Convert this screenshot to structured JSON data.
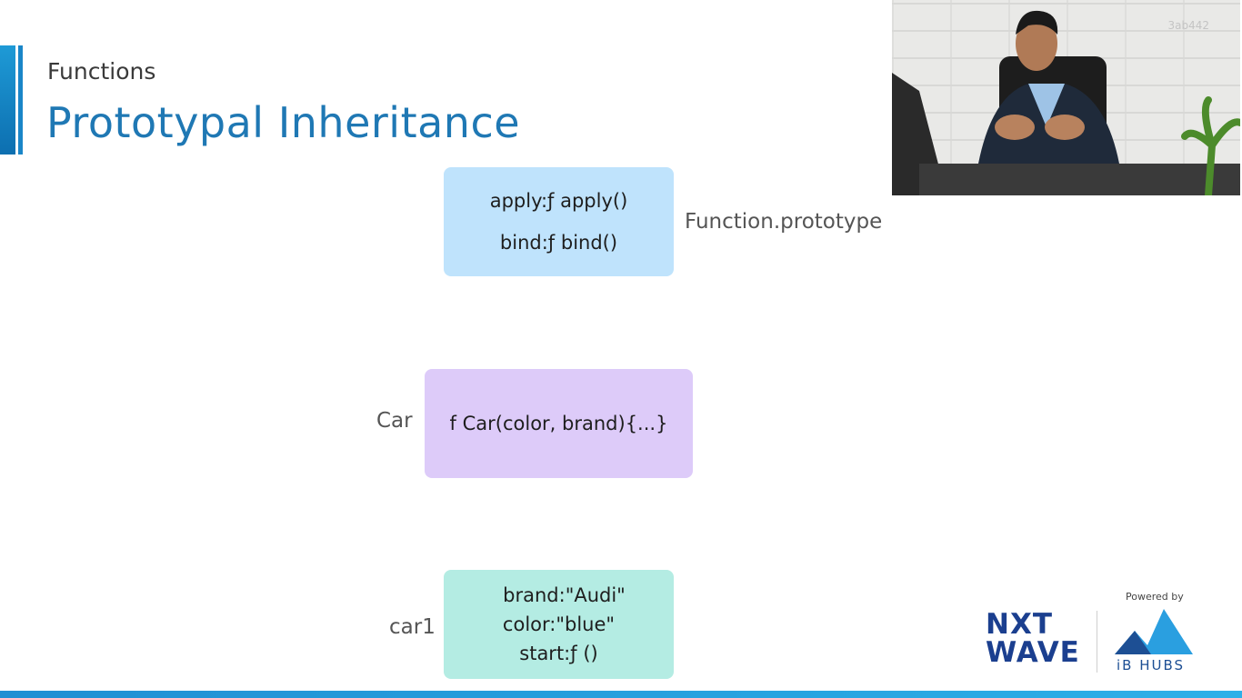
{
  "header": {
    "section": "Functions",
    "title": "Prototypal Inheritance"
  },
  "diagram": {
    "function_prototype": {
      "label": "Function.prototype",
      "props": [
        "apply:ƒ apply()",
        "bind:ƒ bind()"
      ]
    },
    "car": {
      "label": "Car",
      "props": [
        "f Car(color, brand){...}"
      ]
    },
    "car1": {
      "label": "car1",
      "props": [
        "brand:\"Audi\"",
        "color:\"blue\"",
        "start:ƒ ()"
      ]
    }
  },
  "webcam": {
    "id": "3ab442"
  },
  "branding": {
    "logo_nxt_line1": "NXT",
    "logo_nxt_line2": "WAVE",
    "powered_by": "Powered by",
    "partner": "iB HUBS"
  },
  "colors": {
    "title": "#1f78b4",
    "proto_box": "#bfe3fc",
    "car_box": "#ddcbf9",
    "car1_box": "#b4ece3"
  }
}
